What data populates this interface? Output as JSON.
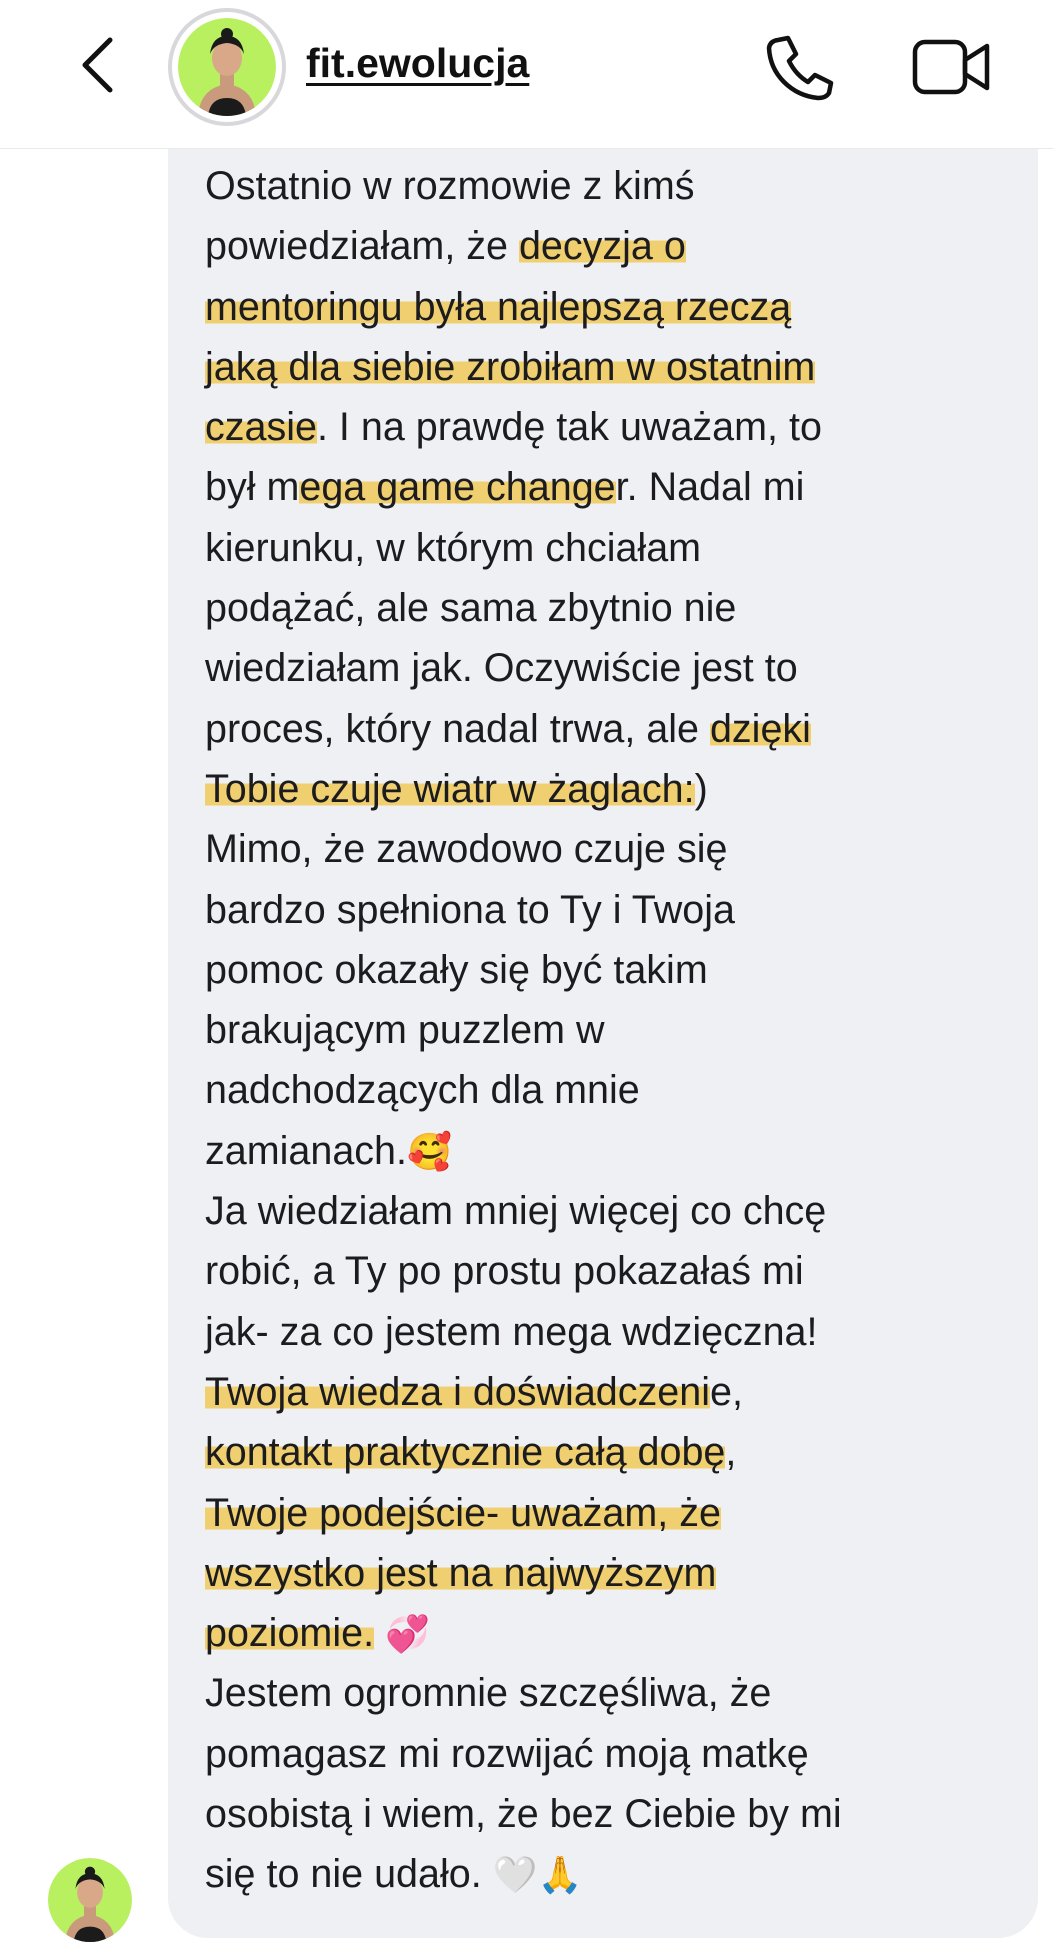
{
  "header": {
    "username": "fit.ewolucja"
  },
  "colors": {
    "highlight": "#f0c95a",
    "avatar_background": "#b8f060",
    "bubble": "#eff0f4"
  },
  "icons": {
    "back": "chevron-left-icon",
    "call": "phone-icon",
    "video": "video-camera-icon",
    "heart": "white-heart-emoji",
    "hands": "folded-hands-emoji"
  },
  "message": {
    "lines": [
      [
        {
          "t": "Ostatnio w rozmowie z kimś",
          "h": false
        }
      ],
      [
        {
          "t": "powiedziałam, że ",
          "h": false
        },
        {
          "t": "decyzja o",
          "h": true
        }
      ],
      [
        {
          "t": "mentoringu była najlepszą rzeczą",
          "h": true
        }
      ],
      [
        {
          "t": "jaką dla siebie zrobiłam w ostatnim",
          "h": true
        }
      ],
      [
        {
          "t": "czasie",
          "h": true
        },
        {
          "t": ". I na prawdę tak uważam, to",
          "h": false
        }
      ],
      [
        {
          "t": "był m",
          "h": false
        },
        {
          "t": "ega game change",
          "h": true
        },
        {
          "t": "r. Nadal mi",
          "h": false
        }
      ],
      [
        {
          "t": "kierunku, w którym chciałam",
          "h": false
        }
      ],
      [
        {
          "t": "podążać, ale sama zbytnio nie",
          "h": false
        }
      ],
      [
        {
          "t": "wiedziałam jak. Oczywiście jest to",
          "h": false
        }
      ],
      [
        {
          "t": "proces, który nadal trwa, ale ",
          "h": false
        },
        {
          "t": "dzięki",
          "h": true
        }
      ],
      [
        {
          "t": "Tobie czuje wiatr w żaglach:",
          "h": true
        },
        {
          "t": ")",
          "h": false
        }
      ],
      [
        {
          "t": "Mimo, że zawodowo czuje się",
          "h": false
        }
      ],
      [
        {
          "t": "bardzo spełniona to Ty i Twoja",
          "h": false
        }
      ],
      [
        {
          "t": "pomoc okazały się być takim",
          "h": false
        }
      ],
      [
        {
          "t": "brakującym puzzlem w",
          "h": false
        }
      ],
      [
        {
          "t": "nadchodzących dla mnie",
          "h": false
        }
      ],
      [
        {
          "t": "zamianach.",
          "h": false
        },
        {
          "t": "🥰",
          "h": false,
          "e": true
        }
      ],
      [
        {
          "t": "Ja wiedziałam mniej więcej co chcę",
          "h": false
        }
      ],
      [
        {
          "t": "robić, a Ty po prostu pokazałaś mi",
          "h": false
        }
      ],
      [
        {
          "t": "jak- za co jestem mega wdzięczna!",
          "h": false
        }
      ],
      [
        {
          "t": "Twoja wiedza i doświadczeni",
          "h": true
        },
        {
          "t": "e,",
          "h": false
        }
      ],
      [
        {
          "t": "kontakt praktycznie całą dobę",
          "h": true
        },
        {
          "t": ",",
          "h": false
        }
      ],
      [
        {
          "t": "Twoje podejście- uważam, że",
          "h": true
        }
      ],
      [
        {
          "t": "wszystko jest na najwyższym",
          "h": true
        }
      ],
      [
        {
          "t": "poziomie.",
          "h": true
        },
        {
          "t": " ",
          "h": false
        },
        {
          "t": "💞",
          "h": false,
          "e": true
        }
      ],
      [
        {
          "t": "Jestem ogromnie szczęśliwa, że",
          "h": false
        }
      ],
      [
        {
          "t": "pomagasz mi rozwijać moją matkę",
          "h": false
        }
      ],
      [
        {
          "t": "osobistą i wiem, że bez Ciebie by mi",
          "h": false
        }
      ],
      [
        {
          "t": "się to nie udało. ",
          "h": false
        },
        {
          "t": "🤍",
          "h": false,
          "e": true
        },
        {
          "t": "🙏",
          "h": false,
          "e": true
        }
      ]
    ]
  }
}
